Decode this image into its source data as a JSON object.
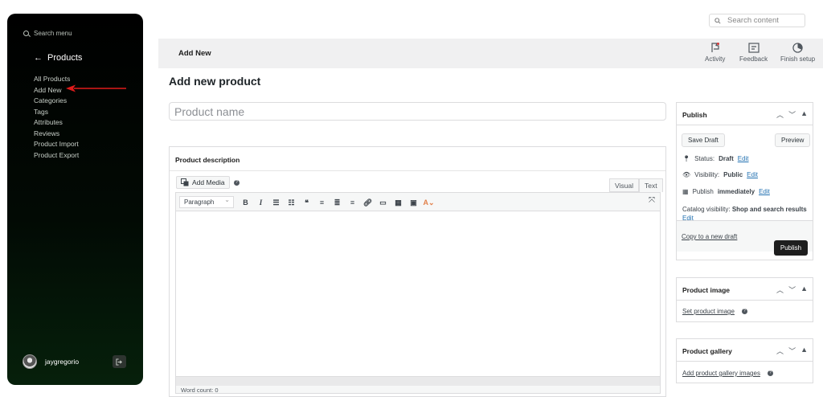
{
  "sidebar": {
    "search_label": "Search menu",
    "back_label": "Products",
    "items": [
      {
        "label": "All Products"
      },
      {
        "label": "Add New"
      },
      {
        "label": "Categories"
      },
      {
        "label": "Tags"
      },
      {
        "label": "Attributes"
      },
      {
        "label": "Reviews"
      },
      {
        "label": "Product Import"
      },
      {
        "label": "Product Export"
      }
    ],
    "username": "jaygregorio"
  },
  "top_search": {
    "placeholder": "Search content"
  },
  "header": {
    "title": "Add New",
    "actions": [
      {
        "label": "Activity",
        "icon": "flag-icon"
      },
      {
        "label": "Feedback",
        "icon": "feedback-icon"
      },
      {
        "label": "Finish setup",
        "icon": "progress-icon"
      }
    ]
  },
  "page_title": "Add new product",
  "product_name": {
    "placeholder": "Product name"
  },
  "description": {
    "title": "Product description",
    "add_media": "Add Media",
    "tabs": {
      "visual": "Visual",
      "text": "Text"
    },
    "format": "Paragraph",
    "word_count": "Word count: 0"
  },
  "publish": {
    "title": "Publish",
    "save_draft": "Save Draft",
    "preview": "Preview",
    "status_label": "Status:",
    "status_value": "Draft",
    "visibility_label": "Visibility:",
    "visibility_value": "Public",
    "publish_label": "Publish",
    "publish_value": "immediately",
    "catalog_label": "Catalog visibility:",
    "catalog_value": "Shop and search results",
    "edit": "Edit",
    "copy_draft": "Copy to a new draft",
    "publish_button": "Publish"
  },
  "product_image": {
    "title": "Product image",
    "link": "Set product image"
  },
  "product_gallery": {
    "title": "Product gallery",
    "link": "Add product gallery images"
  },
  "colors": {
    "sidebar_bg": "#000000",
    "primary_button": "#1e1e1e",
    "link": "#2271b1",
    "annotation_arrow": "#e01b1b"
  }
}
